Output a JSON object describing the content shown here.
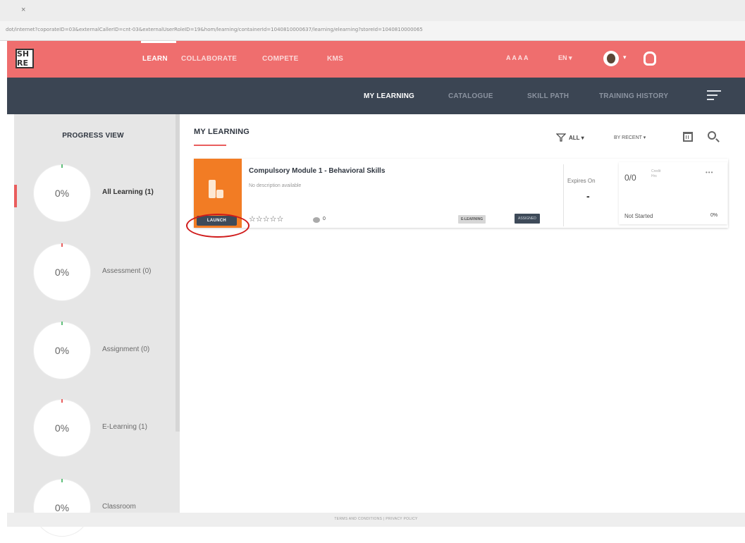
{
  "browser": {
    "tab_glyph": "×",
    "url": "dot/internet?coporateID=03&externalCallerID=cnt-03&externalUserRoleID=19&hom/learning/containerId=1040810000637/learning/elearning?storeId=1040810000065"
  },
  "topnav": {
    "logo_text": "SH RE",
    "items": [
      {
        "label": "LEARN",
        "active": true
      },
      {
        "label": "COLLABORATE",
        "active": false
      },
      {
        "label": "COMPETE",
        "active": false
      },
      {
        "label": "KMS",
        "active": false
      }
    ],
    "font_size_controls": "A A A A",
    "language": "EN ▾",
    "avatar_caret": "▾"
  },
  "subnav": {
    "items": [
      {
        "label": "MY LEARNING",
        "active": true
      },
      {
        "label": "CATALOGUE",
        "active": false
      },
      {
        "label": "SKILL PATH",
        "active": false
      },
      {
        "label": "TRAINING HISTORY",
        "active": false
      }
    ]
  },
  "progress_view": {
    "title": "PROGRESS VIEW",
    "items": [
      {
        "percent": "0%",
        "label": "All Learning (1)",
        "active": true
      },
      {
        "percent": "0%",
        "label": "Assessment (0)",
        "active": false
      },
      {
        "percent": "0%",
        "label": "Assignment (0)",
        "active": false
      },
      {
        "percent": "0%",
        "label": "E-Learning (1)",
        "active": false
      },
      {
        "percent": "0%",
        "label": "Classroom",
        "active": false
      }
    ]
  },
  "main": {
    "heading": "MY LEARNING",
    "filter_label": "ALL ▾",
    "sort_label": "BY RECENT ▾"
  },
  "course": {
    "title": "Compulsory Module 1 - Behavioral Skills",
    "description": "No description available",
    "launch_label": "LAUNCH",
    "stars": "☆☆☆☆☆",
    "comment_count": "0",
    "type_badge": "E-LEARNING",
    "status_badge": "ASSIGNED",
    "expires_label": "Expires On",
    "expires_value": "-",
    "credits_value": "0/0",
    "credits_label": "Credit Hrs",
    "more": "•••",
    "progress_status": "Not Started",
    "progress_percent": "0%"
  },
  "footer": {
    "links": "TERMS AND CONDITIONS | PRIVACY POLICY"
  },
  "colors": {
    "topnav_bg": "#ef6e6e",
    "subnav_bg": "#3b4553",
    "accent_red": "#e95d5d",
    "thumb_orange": "#f27c24",
    "launch_button": "#3e4a59",
    "highlight_ring": "#d01b1b"
  }
}
